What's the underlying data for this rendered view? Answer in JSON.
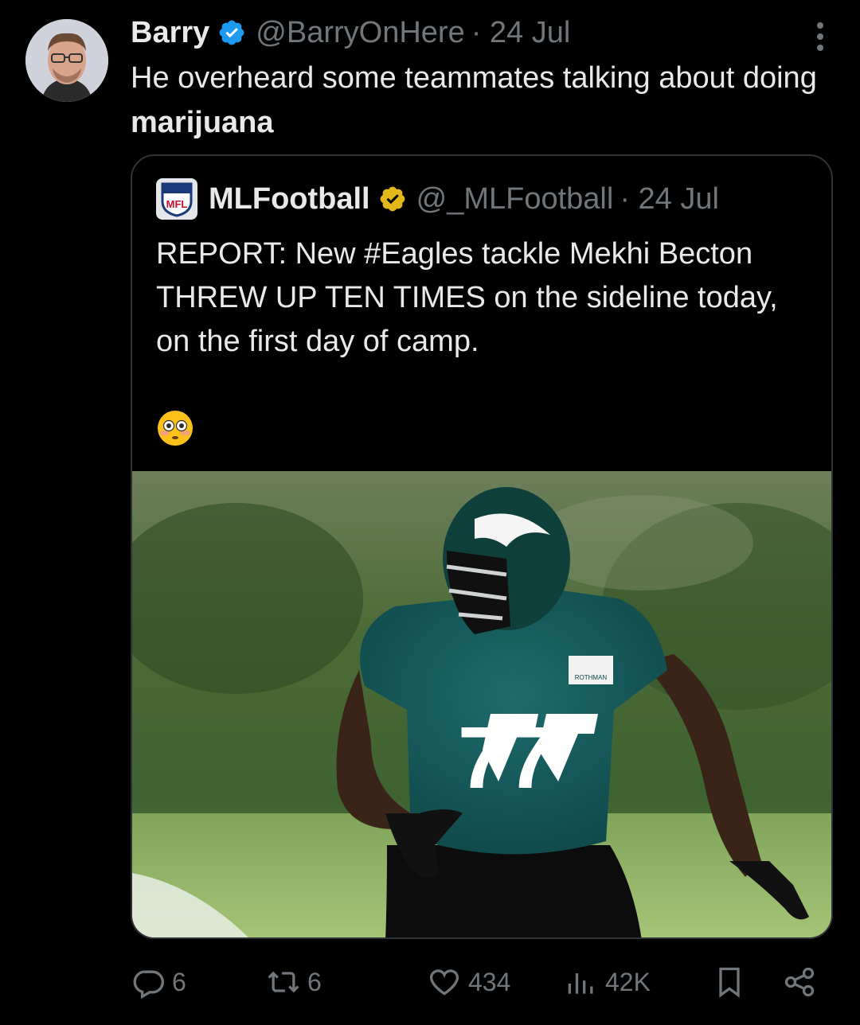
{
  "tweet": {
    "author_name": "Barry",
    "handle": "@BarryOnHere",
    "date": "· 24 Jul",
    "text_before": "He overheard some teammates talking about doing ",
    "text_bold": "marijuana"
  },
  "quote": {
    "author_name": "MLFootball",
    "handle": "@_MLFootball",
    "date": "· 24 Jul",
    "logo_text": "MFL",
    "text": "REPORT: New #Eagles tackle Mekhi Becton THREW UP TEN TIMES on the sideline today, on the first day of camp.",
    "emoji": "😳",
    "image": {
      "jersey_number": "77",
      "patch_text": "ROTHMAN"
    }
  },
  "actions": {
    "replies": "6",
    "reposts": "6",
    "likes": "434",
    "views": "42K"
  },
  "icons": [
    "verified-blue-icon",
    "verified-gold-icon",
    "more-icon",
    "reply-icon",
    "repost-icon",
    "like-icon",
    "views-icon",
    "bookmark-icon",
    "share-icon"
  ],
  "colors": {
    "verified_blue": "#1d9bf0",
    "verified_gold": "#e2b719",
    "muted": "#71767b",
    "text": "#e7e9ea"
  }
}
